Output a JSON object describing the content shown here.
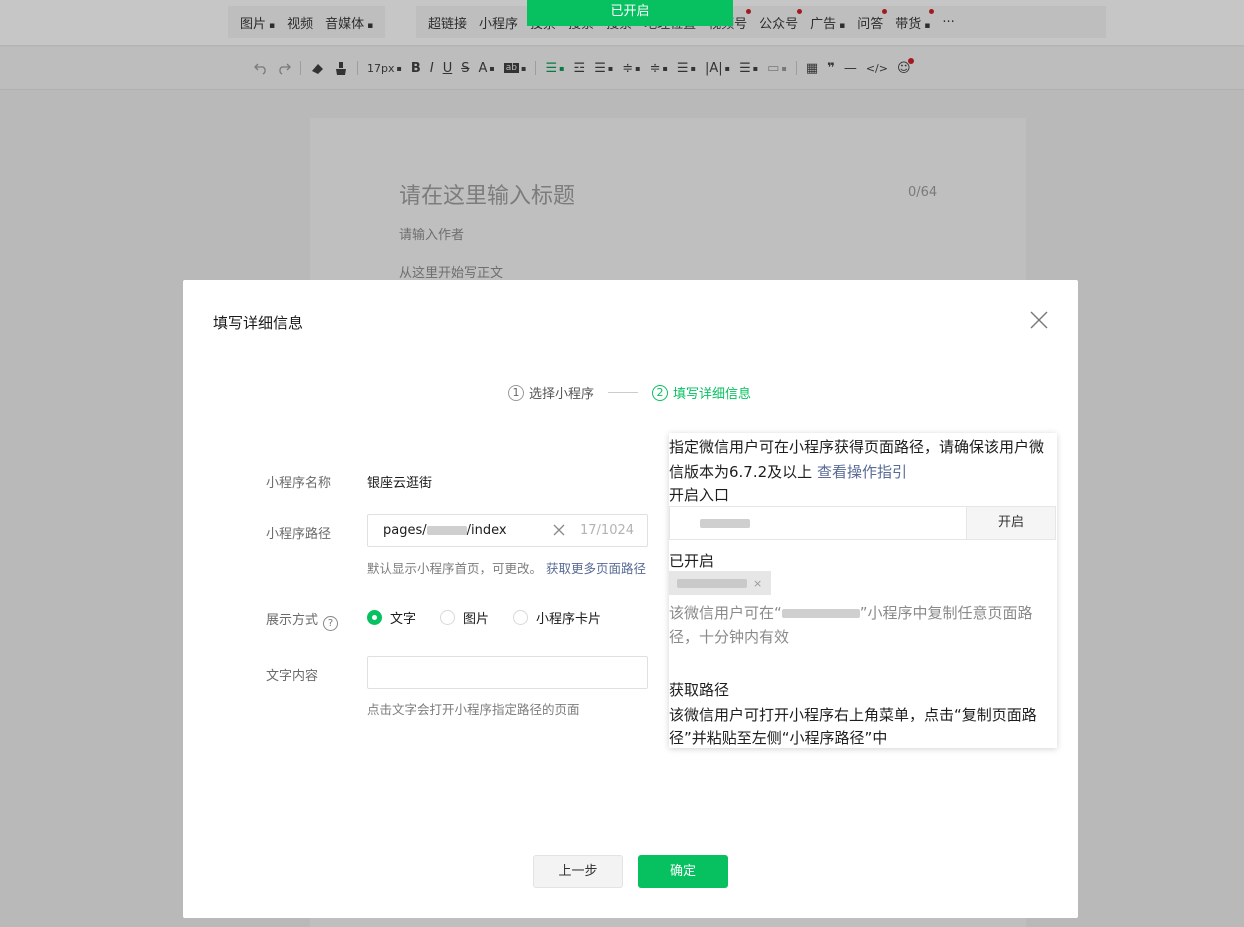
{
  "menu": {
    "group1": [
      {
        "label": "图片",
        "caret": true,
        "dot": false
      },
      {
        "label": "视频",
        "caret": false,
        "dot": false
      },
      {
        "label": "音媒体",
        "caret": true,
        "dot": false
      }
    ],
    "group2": [
      {
        "label": "超链接",
        "caret": false,
        "dot": false
      },
      {
        "label": "小程序",
        "caret": false,
        "dot": false
      },
      {
        "label": "投票",
        "caret": false,
        "dot": false
      },
      {
        "label": "搜索",
        "caret": false,
        "dot": false
      },
      {
        "label": "搜索",
        "caret": false,
        "dot": false
      },
      {
        "label": "地理位置",
        "caret": false,
        "dot": false
      },
      {
        "label": "视频号",
        "caret": false,
        "dot": true
      },
      {
        "label": "公众号",
        "caret": false,
        "dot": true
      },
      {
        "label": "广告",
        "caret": true,
        "dot": false
      },
      {
        "label": "问答",
        "caret": false,
        "dot": true
      },
      {
        "label": "带货",
        "caret": true,
        "dot": true
      },
      {
        "label": "···",
        "caret": false,
        "dot": false
      }
    ]
  },
  "toast": "已开启",
  "toolbar": {
    "font_size": "17px",
    "undo_icon": "undo-icon",
    "redo_icon": "redo-icon"
  },
  "editor": {
    "title_placeholder": "请在这里输入标题",
    "title_count": "0/64",
    "author_placeholder": "请输入作者",
    "body_placeholder": "从这里开始写正文"
  },
  "dialog": {
    "title": "填写详细信息",
    "steps": [
      {
        "num": "1",
        "label": "选择小程序",
        "active": false
      },
      {
        "num": "2",
        "label": "填写详细信息",
        "active": true
      }
    ],
    "name_label": "小程序名称",
    "name_value": "银座云逛街",
    "path_label": "小程序路径",
    "path_prefix": "pages/",
    "path_suffix": "/index",
    "path_counter": "17/1024",
    "path_hint": "默认显示小程序首页，可更改。",
    "path_hint_link": "获取更多页面路径",
    "display_label": "展示方式",
    "display_help": "?",
    "display_options": [
      {
        "label": "文字",
        "checked": true
      },
      {
        "label": "图片",
        "checked": false
      },
      {
        "label": "小程序卡片",
        "checked": false
      }
    ],
    "text_label": "文字内容",
    "text_value": "",
    "text_hint": "点击文字会打开小程序指定路径的页面",
    "prev_button": "上一步",
    "ok_button": "确定"
  },
  "popover": {
    "line1": "指定微信用户可在小程序获得页面路径，请确保该用户微",
    "line2_prefix": "信版本为6.7.2及以上 ",
    "line2_link": "查看操作指引",
    "entry_title": "开启入口",
    "enable_button": "开启",
    "enabled_title": "已开启",
    "tag_close": "×",
    "desc_line1_a": "该微信用户可在“",
    "desc_line1_b": "”小程序中复制任意页面路",
    "desc_line2": "径，十分钟内有效",
    "get_path_title": "获取路径",
    "get_path_line1": "该微信用户可打开小程序右上角菜单，点击“复制页面路",
    "get_path_line2": "径”并粘贴至左侧“小程序路径”中"
  },
  "colors": {
    "accent": "#07c160",
    "link": "#576b95"
  }
}
